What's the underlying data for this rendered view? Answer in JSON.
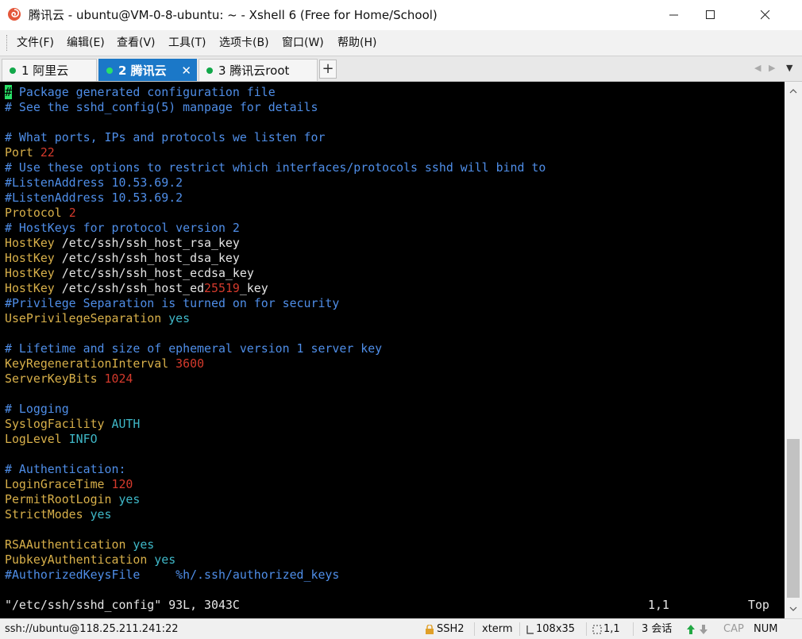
{
  "window": {
    "title": "腾讯云 - ubuntu@VM-0-8-ubuntu: ~ - Xshell 6 (Free for Home/School)",
    "app_icon": "xshell-shell-icon"
  },
  "menu": {
    "items": [
      "文件(F)",
      "编辑(E)",
      "查看(V)",
      "工具(T)",
      "选项卡(B)",
      "窗口(W)",
      "帮助(H)"
    ]
  },
  "tabs": [
    {
      "label": "1 阿里云",
      "active": false,
      "status_color": "#12a84a"
    },
    {
      "label": "2 腾讯云",
      "active": true,
      "status_color": "#29e06a"
    },
    {
      "label": "3 腾讯云root",
      "active": false,
      "status_color": "#12a84a"
    }
  ],
  "tab_add_label": "+",
  "terminal": {
    "lines": [
      [
        {
          "t": "#",
          "c": "cursor"
        },
        {
          "t": " Package generated configuration file",
          "c": "comment"
        }
      ],
      [
        {
          "t": "# See the sshd_config(5) manpage for details",
          "c": "comment"
        }
      ],
      [],
      [
        {
          "t": "# What ports, IPs and protocols we listen for",
          "c": "comment"
        }
      ],
      [
        {
          "t": "Port ",
          "c": "key"
        },
        {
          "t": "22",
          "c": "num"
        }
      ],
      [
        {
          "t": "# Use these options to restrict which interfaces/protocols sshd will bind to",
          "c": "comment"
        }
      ],
      [
        {
          "t": "#ListenAddress 10.53.69.2",
          "c": "comment"
        }
      ],
      [
        {
          "t": "#ListenAddress 10.53.69.2",
          "c": "comment"
        }
      ],
      [
        {
          "t": "Protocol ",
          "c": "key"
        },
        {
          "t": "2",
          "c": "num"
        }
      ],
      [
        {
          "t": "# HostKeys for protocol version 2",
          "c": "comment"
        }
      ],
      [
        {
          "t": "HostKey ",
          "c": "key"
        },
        {
          "t": "/etc/ssh/ssh_host_rsa_key",
          "c": "plain"
        }
      ],
      [
        {
          "t": "HostKey ",
          "c": "key"
        },
        {
          "t": "/etc/ssh/ssh_host_dsa_key",
          "c": "plain"
        }
      ],
      [
        {
          "t": "HostKey ",
          "c": "key"
        },
        {
          "t": "/etc/ssh/ssh_host_ecdsa_key",
          "c": "plain"
        }
      ],
      [
        {
          "t": "HostKey ",
          "c": "key"
        },
        {
          "t": "/etc/ssh/ssh_host_ed",
          "c": "plain"
        },
        {
          "t": "25519",
          "c": "num"
        },
        {
          "t": "_key",
          "c": "plain"
        }
      ],
      [
        {
          "t": "#Privilege Separation is turned on for security",
          "c": "comment"
        }
      ],
      [
        {
          "t": "UsePrivilegeSeparation ",
          "c": "key"
        },
        {
          "t": "yes",
          "c": "const"
        }
      ],
      [],
      [
        {
          "t": "# Lifetime and size of ephemeral version 1 server key",
          "c": "comment"
        }
      ],
      [
        {
          "t": "KeyRegenerationInterval ",
          "c": "key"
        },
        {
          "t": "3600",
          "c": "num"
        }
      ],
      [
        {
          "t": "ServerKeyBits ",
          "c": "key"
        },
        {
          "t": "1024",
          "c": "num"
        }
      ],
      [],
      [
        {
          "t": "# Logging",
          "c": "comment"
        }
      ],
      [
        {
          "t": "SyslogFacility ",
          "c": "key"
        },
        {
          "t": "AUTH",
          "c": "const"
        }
      ],
      [
        {
          "t": "LogLevel ",
          "c": "key"
        },
        {
          "t": "INFO",
          "c": "const"
        }
      ],
      [],
      [
        {
          "t": "# Authentication:",
          "c": "comment"
        }
      ],
      [
        {
          "t": "LoginGraceTime ",
          "c": "key"
        },
        {
          "t": "120",
          "c": "num"
        }
      ],
      [
        {
          "t": "PermitRootLogin ",
          "c": "key"
        },
        {
          "t": "yes",
          "c": "const"
        }
      ],
      [
        {
          "t": "StrictModes ",
          "c": "key"
        },
        {
          "t": "yes",
          "c": "const"
        }
      ],
      [],
      [
        {
          "t": "RSAAuthentication ",
          "c": "key"
        },
        {
          "t": "yes",
          "c": "const"
        }
      ],
      [
        {
          "t": "PubkeyAuthentication ",
          "c": "key"
        },
        {
          "t": "yes",
          "c": "const"
        }
      ],
      [
        {
          "t": "#AuthorizedKeysFile     %h/.ssh/authorized_keys",
          "c": "comment"
        }
      ]
    ],
    "vim_file_info": "\"/etc/ssh/sshd_config\" 93L, 3043C",
    "vim_cursor_pos": "1,1",
    "vim_scroll": "Top",
    "colors": {
      "comment": "#4f8ee8",
      "key": "#d8b04a",
      "num": "#d43a2c",
      "const": "#3fb8c8",
      "plain": "#e6e6e6",
      "cursor_bg": "#29e066"
    }
  },
  "statusbar": {
    "connection": "ssh://ubuntu@118.25.211.241:22",
    "protocol": "SSH2",
    "term_type": "xterm",
    "size": "108x35",
    "cursor": "1,1",
    "sessions": "3 会话",
    "cap": "CAP",
    "num": "NUM"
  }
}
